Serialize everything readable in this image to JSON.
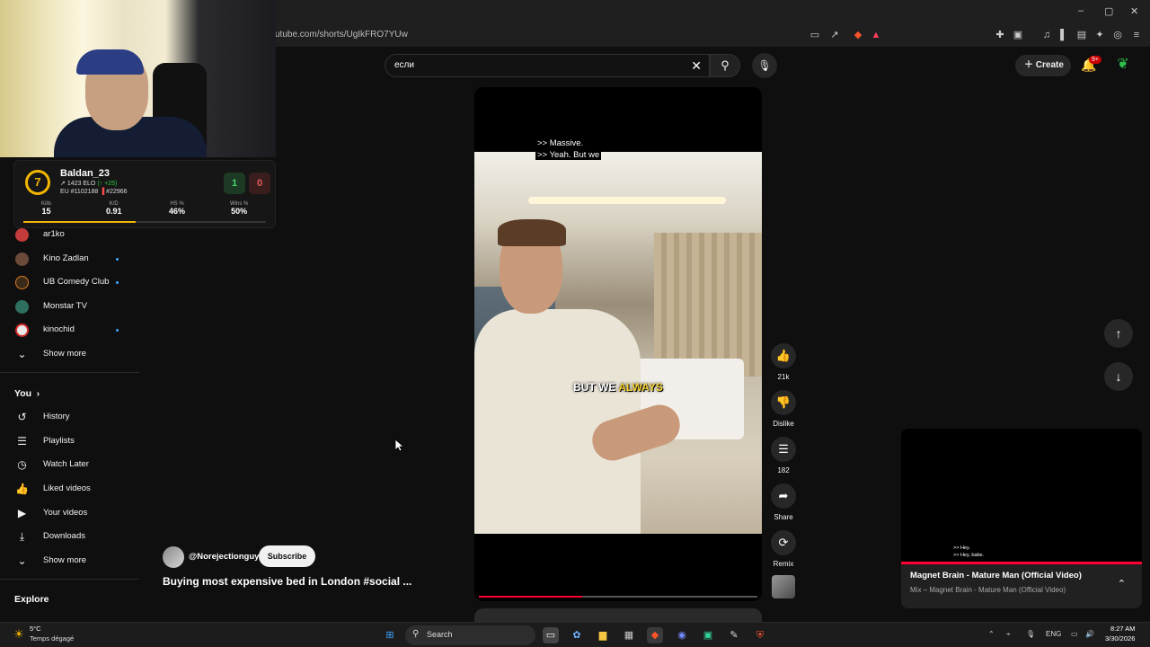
{
  "browser": {
    "url": "utube.com/shorts/UgIkFRO7YUw",
    "window_controls": [
      "–",
      "▢",
      "✕"
    ]
  },
  "stream_overlay": {
    "faceit": {
      "level": "7",
      "username": "Baldan_23",
      "elo": "1423 ELO",
      "elo_change": "(↑ +25)",
      "region_rank": "EU #1102188",
      "country_rank": "#22966",
      "wins": "1",
      "losses": "0",
      "stats": [
        {
          "label": "Kills",
          "value": "15"
        },
        {
          "label": "K/D",
          "value": "0.91"
        },
        {
          "label": "HS %",
          "value": "46%"
        },
        {
          "label": "Wins %",
          "value": "50%"
        }
      ]
    }
  },
  "sidebar": {
    "subscriptions": [
      {
        "label": "ar1ko",
        "avatar_color": "#c43b3b",
        "new": false
      },
      {
        "label": "Kino Zadlan",
        "avatar_color": "#6b4a3a",
        "new": true
      },
      {
        "label": "UB Comedy Club",
        "avatar_color": "#3a2a1a",
        "new": true
      },
      {
        "label": "Monstar TV",
        "avatar_color": "#2f6f5f",
        "new": false
      },
      {
        "label": "kinochid",
        "avatar_color": "#e8e8e8",
        "new": true
      }
    ],
    "show_more_1": "Show more",
    "you_title": "You",
    "you_items": [
      {
        "label": "History",
        "icon": "history-icon",
        "glyph": "↺"
      },
      {
        "label": "Playlists",
        "icon": "playlists-icon",
        "glyph": "☰"
      },
      {
        "label": "Watch Later",
        "icon": "clock-icon",
        "glyph": "◷"
      },
      {
        "label": "Liked videos",
        "icon": "thumbs-up-icon",
        "glyph": "👍"
      },
      {
        "label": "Your videos",
        "icon": "video-icon",
        "glyph": "▶"
      },
      {
        "label": "Downloads",
        "icon": "download-icon",
        "glyph": "⤓"
      }
    ],
    "show_more_2": "Show more",
    "explore_title": "Explore"
  },
  "header": {
    "search_query": "если",
    "create_label": "Create",
    "notifications_badge": "9+"
  },
  "short": {
    "subtitle_line1": ">> Massive.",
    "subtitle_line2": ">> Yeah. But we",
    "caption_plain": "BUT WE ",
    "caption_highlight": "ALWAYS",
    "progress": 0.37,
    "channel": "@Norejectionguy",
    "subscribe_label": "Subscribe",
    "title": "Buying most expensive bed in London #social ..."
  },
  "actions": [
    {
      "name": "like",
      "icon": "thumbs-up-icon",
      "glyph": "👍",
      "label": "21k"
    },
    {
      "name": "dislike",
      "icon": "thumbs-down-icon",
      "glyph": "👎",
      "label": "Dislike"
    },
    {
      "name": "comments",
      "icon": "comment-icon",
      "glyph": "☰",
      "label": "182"
    },
    {
      "name": "share",
      "icon": "share-icon",
      "glyph": "➦",
      "label": "Share"
    },
    {
      "name": "remix",
      "icon": "remix-icon",
      "glyph": "⟳",
      "label": "Remix"
    }
  ],
  "miniplayer": {
    "sub_line1": ">> Hey.",
    "sub_line2": ">> Hey, babe.",
    "title": "Magnet Brain - Mature Man (Official Video)",
    "subtitle": "Mix – Magnet Brain - Mature Man (Official Video)"
  },
  "taskbar": {
    "weather_temp": "5°C",
    "weather_desc": "Temps dégagé",
    "search_label": "Search",
    "language": "ENG",
    "time": "8:27 AM",
    "date": "3/30/2026"
  }
}
